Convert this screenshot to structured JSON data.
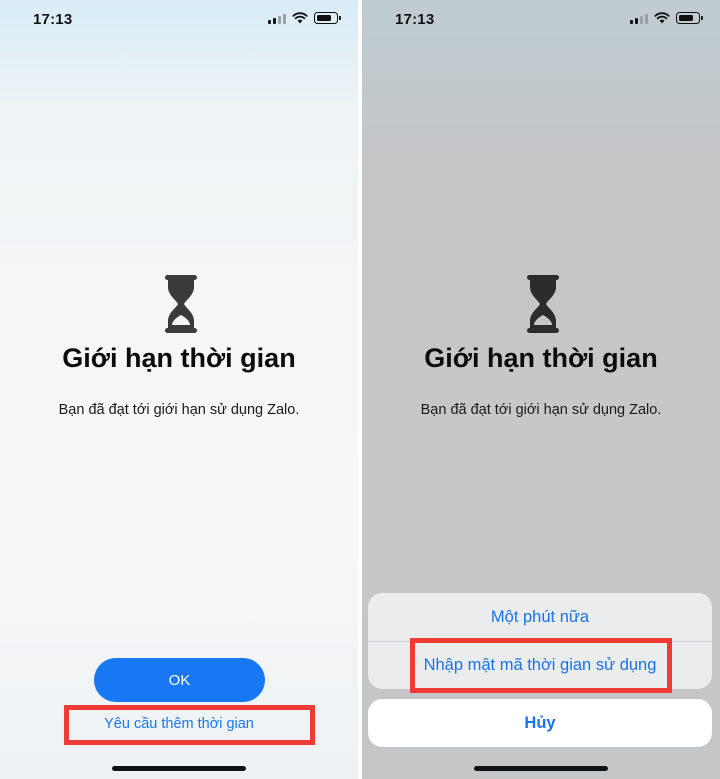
{
  "left_screen": {
    "status_time": "17:13",
    "title": "Giới hạn thời gian",
    "message": "Bạn đã đạt tới giới hạn sử dụng Zalo.",
    "ok_label": "OK",
    "request_more_label": "Yêu cầu thêm thời gian"
  },
  "right_screen": {
    "status_time": "17:13",
    "title": "Giới hạn thời gian",
    "message": "Bạn đã đạt tới giới hạn sử dụng Zalo.",
    "action_sheet": {
      "options": [
        "Một phút nữa",
        "Nhập mật mã thời gian sử dụng"
      ],
      "cancel_label": "Hủy"
    }
  },
  "icons": {
    "hourglass": "hourglass-icon",
    "signal": "cellular-signal-icon",
    "wifi": "wifi-icon",
    "battery": "battery-icon"
  },
  "colors": {
    "accent_blue": "#1877f2",
    "highlight_red": "#ee3b35"
  }
}
